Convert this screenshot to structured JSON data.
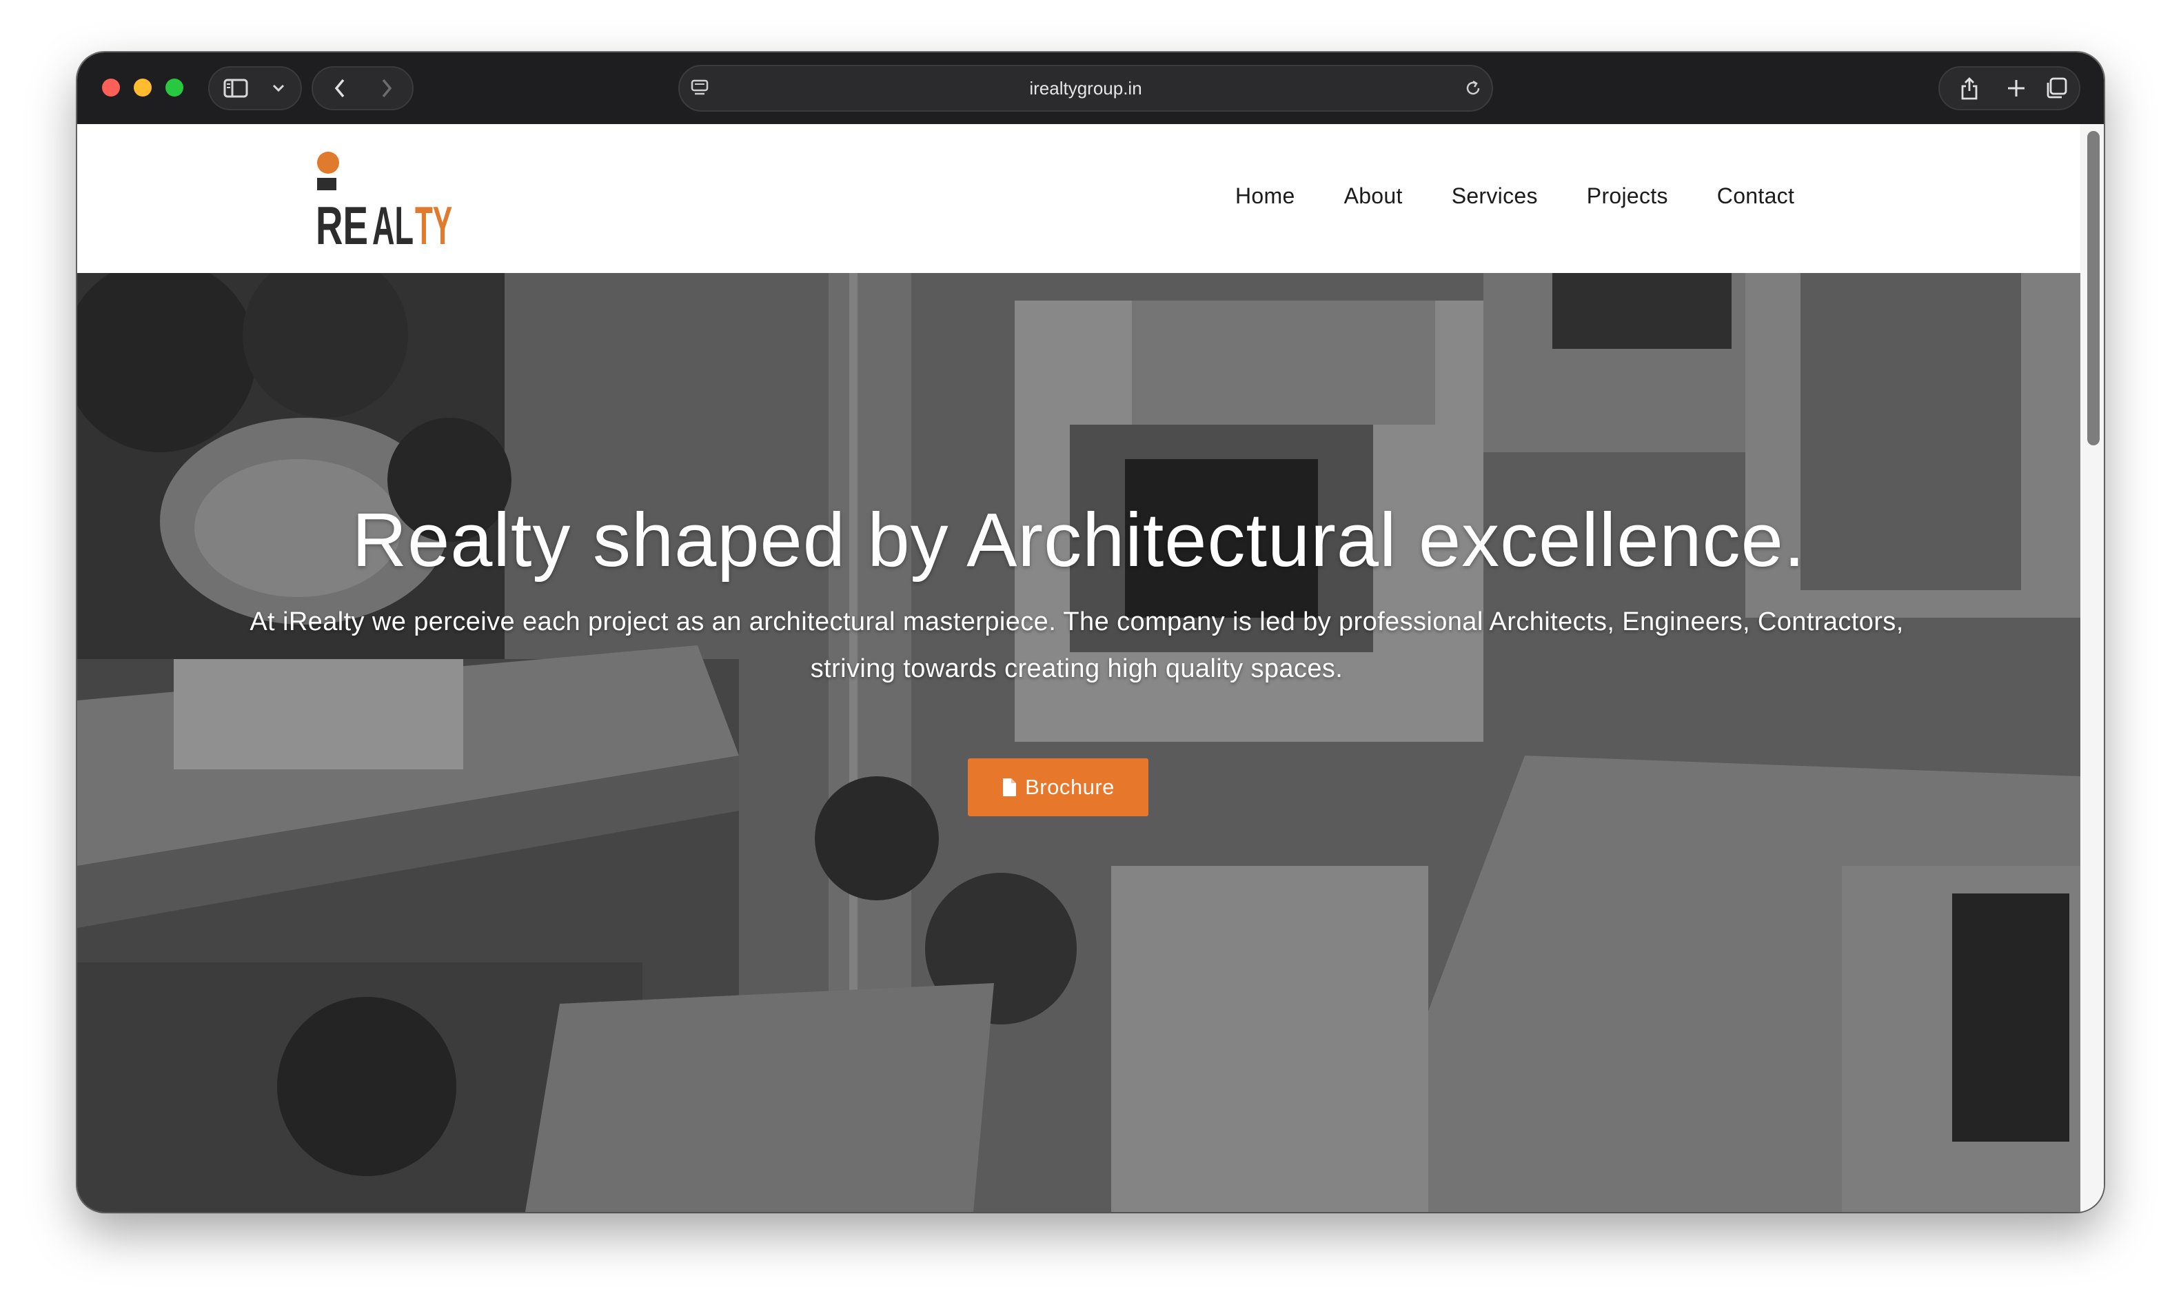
{
  "browser": {
    "url": "irealtygroup.in",
    "icons": {
      "sidebar": "sidebar-icon",
      "chevron": "chevron-down-icon",
      "back": "back-arrow-icon",
      "forward": "forward-arrow-icon",
      "site_settings": "page-settings-icon",
      "reload": "reload-icon",
      "share": "share-icon",
      "new_tab": "plus-icon",
      "tabs": "tab-overview-icon"
    }
  },
  "site": {
    "logo_text": "REALTY",
    "logo_accent": "#e07a2c",
    "nav": [
      {
        "label": "Home"
      },
      {
        "label": "About"
      },
      {
        "label": "Services"
      },
      {
        "label": "Projects"
      },
      {
        "label": "Contact"
      }
    ]
  },
  "hero": {
    "title": "Realty shaped by Architectural excellence.",
    "description": "At iRealty we perceive each project as an architectural masterpiece. The company is led by professional Architects, Engineers, Contractors, striving towards creating high quality spaces.",
    "button_label": "Brochure",
    "button_icon": "file-icon",
    "button_color": "#e7772a",
    "background": "grayscale aerial photo of city buildings"
  }
}
